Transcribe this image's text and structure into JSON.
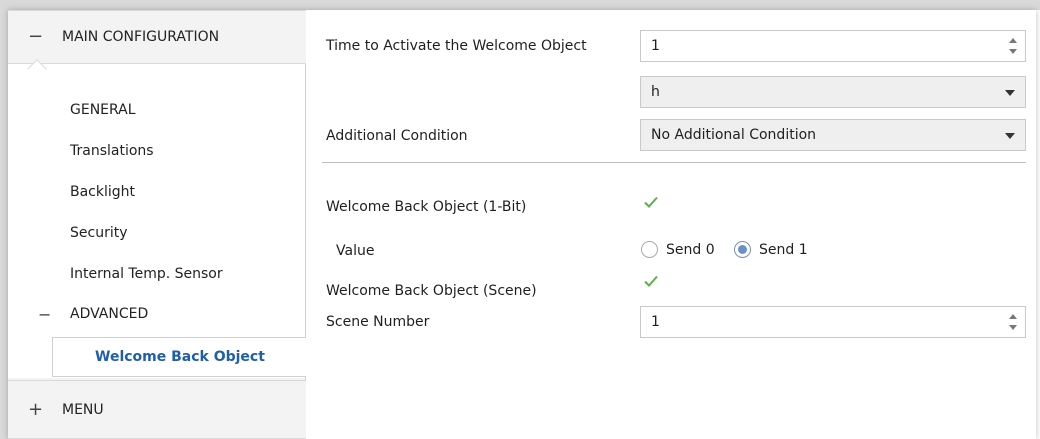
{
  "sidebar": {
    "main_section": {
      "sign": "−",
      "label": "MAIN CONFIGURATION"
    },
    "items": [
      {
        "label": "GENERAL"
      },
      {
        "label": "Translations"
      },
      {
        "label": "Backlight"
      },
      {
        "label": "Security"
      },
      {
        "label": "Internal Temp. Sensor"
      }
    ],
    "advanced": {
      "sign": "−",
      "label": "ADVANCED"
    },
    "active_item": {
      "label": "Welcome Back Object"
    },
    "menu_section": {
      "sign": "+",
      "label": "MENU"
    }
  },
  "form": {
    "time_label": "Time to Activate the Welcome Object",
    "time_value": "1",
    "unit_value": "h",
    "additional_label": "Additional Condition",
    "additional_value": "No Additional Condition",
    "wb1bit_label": "Welcome Back Object (1-Bit)",
    "value_label": "Value",
    "radio_send0": "Send 0",
    "radio_send1": "Send 1",
    "radio_selected": "Send 1",
    "wbscene_label": "Welcome Back Object (Scene)",
    "scene_label": "Scene Number",
    "scene_value": "1"
  },
  "colors": {
    "accent": "#1f5ea8",
    "check": "#5fb04a",
    "radio": "#6c8fc9"
  },
  "icons": {
    "check": "checkmark-icon",
    "spin": "spinner-arrows-icon",
    "dropdown": "chevron-down-icon"
  }
}
